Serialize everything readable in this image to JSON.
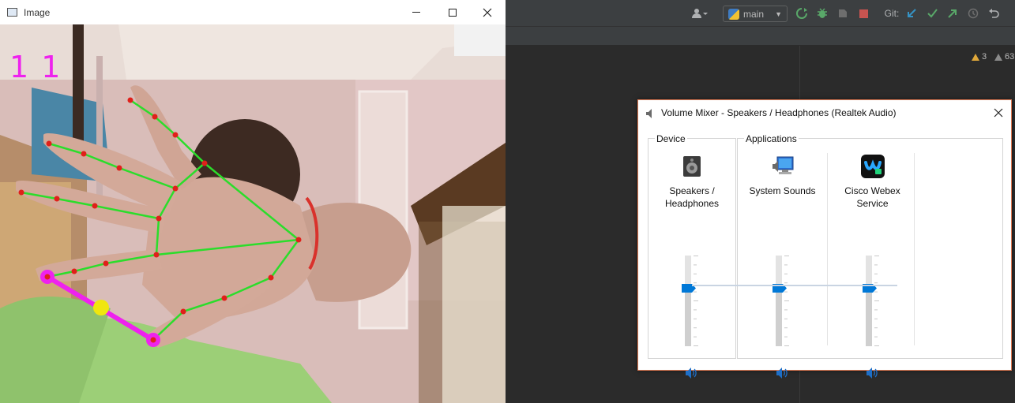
{
  "image_window": {
    "title": "Image",
    "finger_count": "1 1"
  },
  "ide": {
    "branch": "main",
    "git_label": "Git:",
    "warnings": "3",
    "weak_warnings": "63"
  },
  "volume_mixer": {
    "title": "Volume Mixer - Speakers / Headphones (Realtek Audio)",
    "device_group": "Device",
    "applications_group": "Applications",
    "device": {
      "name_line1": "Speakers /",
      "name_line2": "Headphones",
      "level": 0.66
    },
    "apps": [
      {
        "name_line1": "System Sounds",
        "name_line2": "",
        "level": 0.66,
        "icon": "system-sounds-icon"
      },
      {
        "name_line1": "Cisco Webex",
        "name_line2": "Service",
        "level": 0.66,
        "icon": "cisco-webex-icon"
      }
    ],
    "colors": {
      "accent": "#0078d7",
      "border": "#e07a52"
    }
  }
}
